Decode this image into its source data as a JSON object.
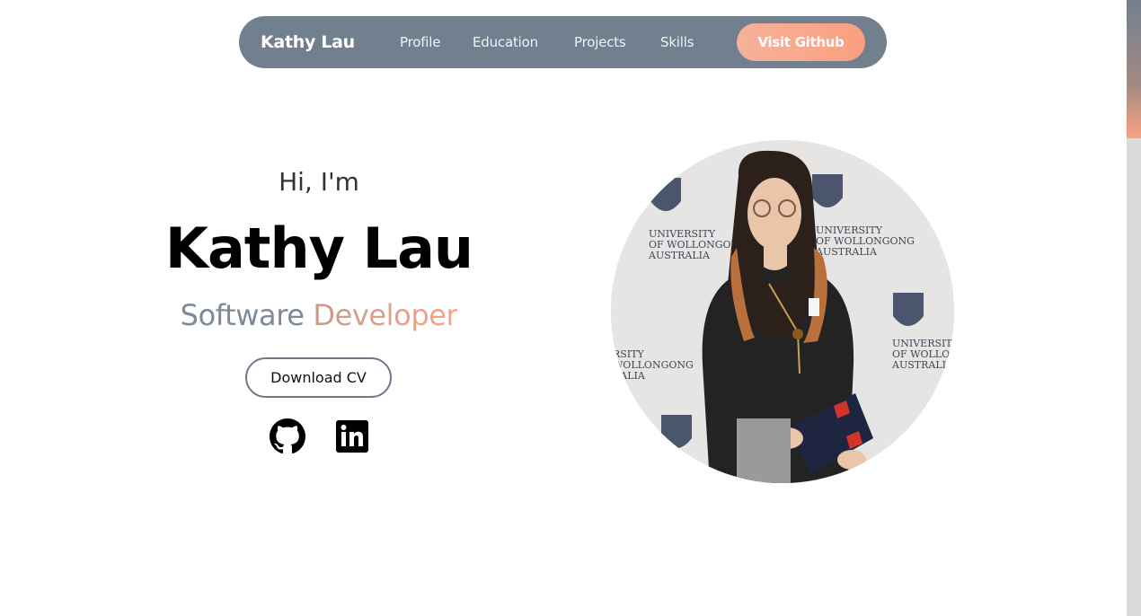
{
  "nav": {
    "brand": "Kathy Lau",
    "links": [
      "Profile",
      "Education",
      "Projects",
      "Skills"
    ],
    "cta": "Visit Github"
  },
  "hero": {
    "greeting": "Hi, I'm",
    "name": "Kathy Lau",
    "role_part1": "Software",
    "role_part2": "Developer",
    "download_cv": "Download CV"
  },
  "social": {
    "icons": [
      "github-icon",
      "linkedin-icon"
    ]
  },
  "photo": {
    "backdrop_logos": [
      "UNIVERSITY",
      "OF WOLLONGONG",
      "AUSTRALIA"
    ]
  },
  "colors": {
    "nav_bg": "#727f8f",
    "accent": "#fb9f7e",
    "role_gray": "#7f8a97"
  }
}
